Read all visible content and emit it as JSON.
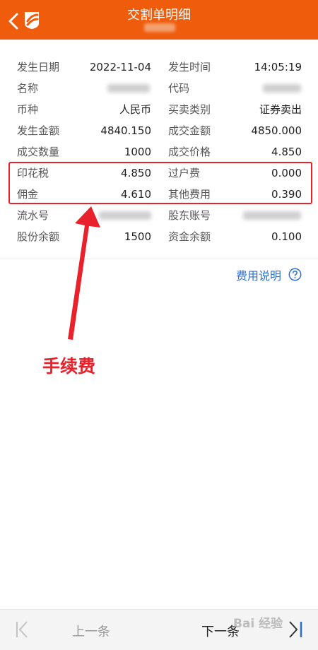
{
  "header": {
    "title": "交割单明细"
  },
  "rows": [
    {
      "l1": "发生日期",
      "v1": "2022-11-04",
      "l2": "发生时间",
      "v2": "14:05:19"
    },
    {
      "l1": "名称",
      "v1": "",
      "l2": "代码",
      "v2": ""
    },
    {
      "l1": "币种",
      "v1": "人民币",
      "l2": "买卖类别",
      "v2": "证券卖出"
    },
    {
      "l1": "发生金额",
      "v1": "4840.150",
      "l2": "成交金额",
      "v2": "4850.000"
    },
    {
      "l1": "成交数量",
      "v1": "1000",
      "l2": "成交价格",
      "v2": "4.850"
    },
    {
      "l1": "印花税",
      "v1": "4.850",
      "l2": "过户费",
      "v2": "0.000"
    },
    {
      "l1": "佣金",
      "v1": "4.610",
      "l2": "其他费用",
      "v2": "0.390"
    },
    {
      "l1": "流水号",
      "v1": "",
      "l2": "股东账号",
      "v2": ""
    },
    {
      "l1": "股份余额",
      "v1": "1500",
      "l2": "资金余额",
      "v2": "0.100"
    }
  ],
  "fee_link": "费用说明",
  "annotation": "手续费",
  "footer": {
    "prev_label": "上一条",
    "next_label": "下一条",
    "watermark": "Bai 经验"
  },
  "colors": {
    "header": "#ee5c0c",
    "annotation": "#e8212a",
    "link": "#2f6fcf"
  },
  "icons": [
    "back-arrow-icon",
    "app-logo-icon",
    "question-icon",
    "arrow-annotation-icon",
    "prev-page-icon",
    "next-page-icon"
  ]
}
